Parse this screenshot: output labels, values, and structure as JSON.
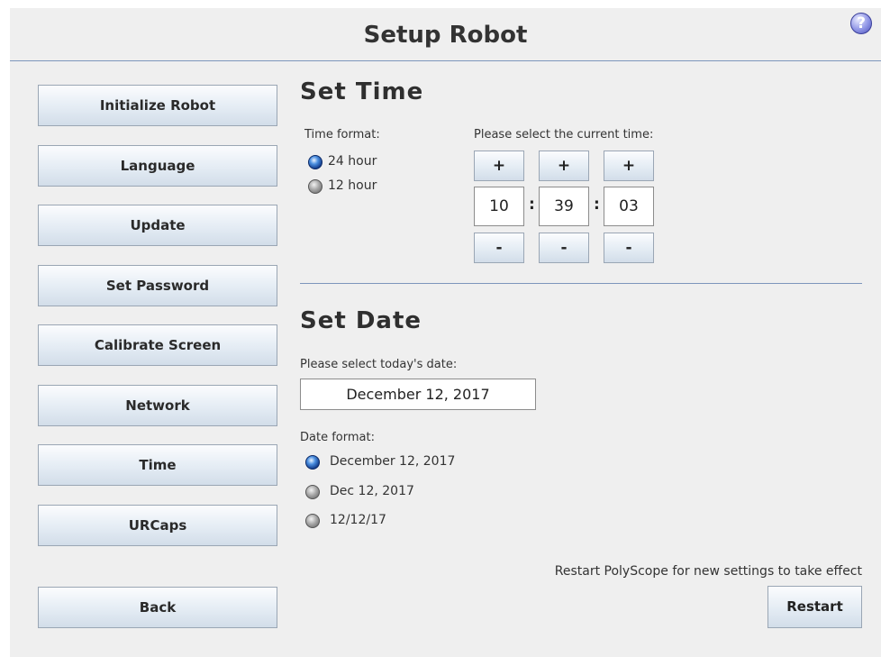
{
  "header": {
    "title": "Setup Robot",
    "help_icon": "question-circle-icon",
    "help_glyph": "?"
  },
  "sidebar": {
    "items": [
      {
        "label": "Initialize Robot"
      },
      {
        "label": "Language"
      },
      {
        "label": "Update"
      },
      {
        "label": "Set Password"
      },
      {
        "label": "Calibrate Screen"
      },
      {
        "label": "Network"
      },
      {
        "label": "Time"
      },
      {
        "label": "URCaps"
      }
    ],
    "back_label": "Back"
  },
  "time": {
    "heading": "Set Time",
    "format_label": "Time format:",
    "format_options": [
      {
        "label": "24 hour",
        "selected": true
      },
      {
        "label": "12 hour",
        "selected": false
      }
    ],
    "select_label": "Please select the current time:",
    "increment_label": "+",
    "decrement_label": "-",
    "separator": ":",
    "hours": "10",
    "minutes": "39",
    "seconds": "03"
  },
  "date": {
    "heading": "Set Date",
    "select_label": "Please select today's date:",
    "value": "December 12, 2017",
    "format_label": "Date format:",
    "format_options": [
      {
        "label": "December 12, 2017",
        "selected": true
      },
      {
        "label": "Dec 12, 2017",
        "selected": false
      },
      {
        "label": "12/12/17",
        "selected": false
      }
    ]
  },
  "footer": {
    "note": "Restart PolyScope for new settings to take effect",
    "restart_label": "Restart"
  },
  "colors": {
    "background": "#efefef",
    "rule": "#7d96bc",
    "radio_selected": "#123b8a"
  }
}
